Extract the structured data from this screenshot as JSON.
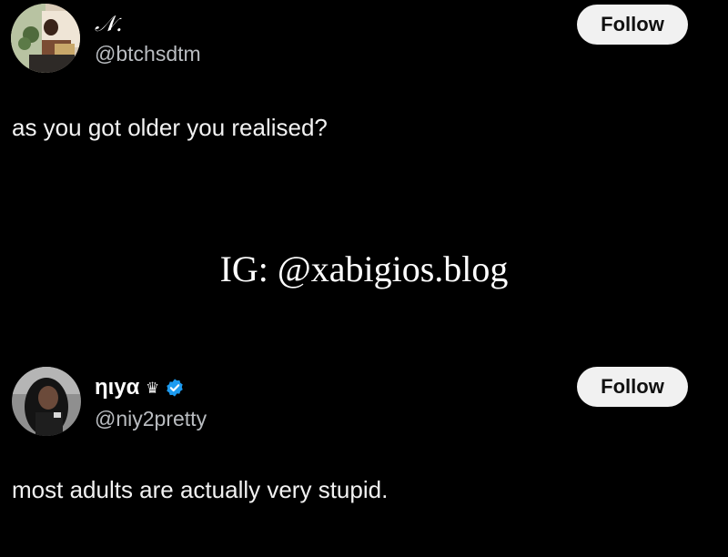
{
  "posts": [
    {
      "display_name": "𝒩.",
      "handle": "@btchsdtm",
      "follow_label": "Follow",
      "text": "as you got older you realised?",
      "avatar_icon": "user-avatar"
    },
    {
      "display_name": "ηιуα",
      "handle": "@niy2pretty",
      "follow_label": "Follow",
      "text": "most adults are actually very stupid.",
      "avatar_icon": "user-avatar",
      "badges": [
        "crown-icon",
        "verified-icon"
      ]
    }
  ],
  "watermark": "IG: @xabigios.blog",
  "colors": {
    "background": "#000000",
    "text": "#e7e9ea",
    "handle": "#b9bcc0",
    "follow_bg": "#f1f1f1",
    "verified": "#1d9bf0"
  }
}
